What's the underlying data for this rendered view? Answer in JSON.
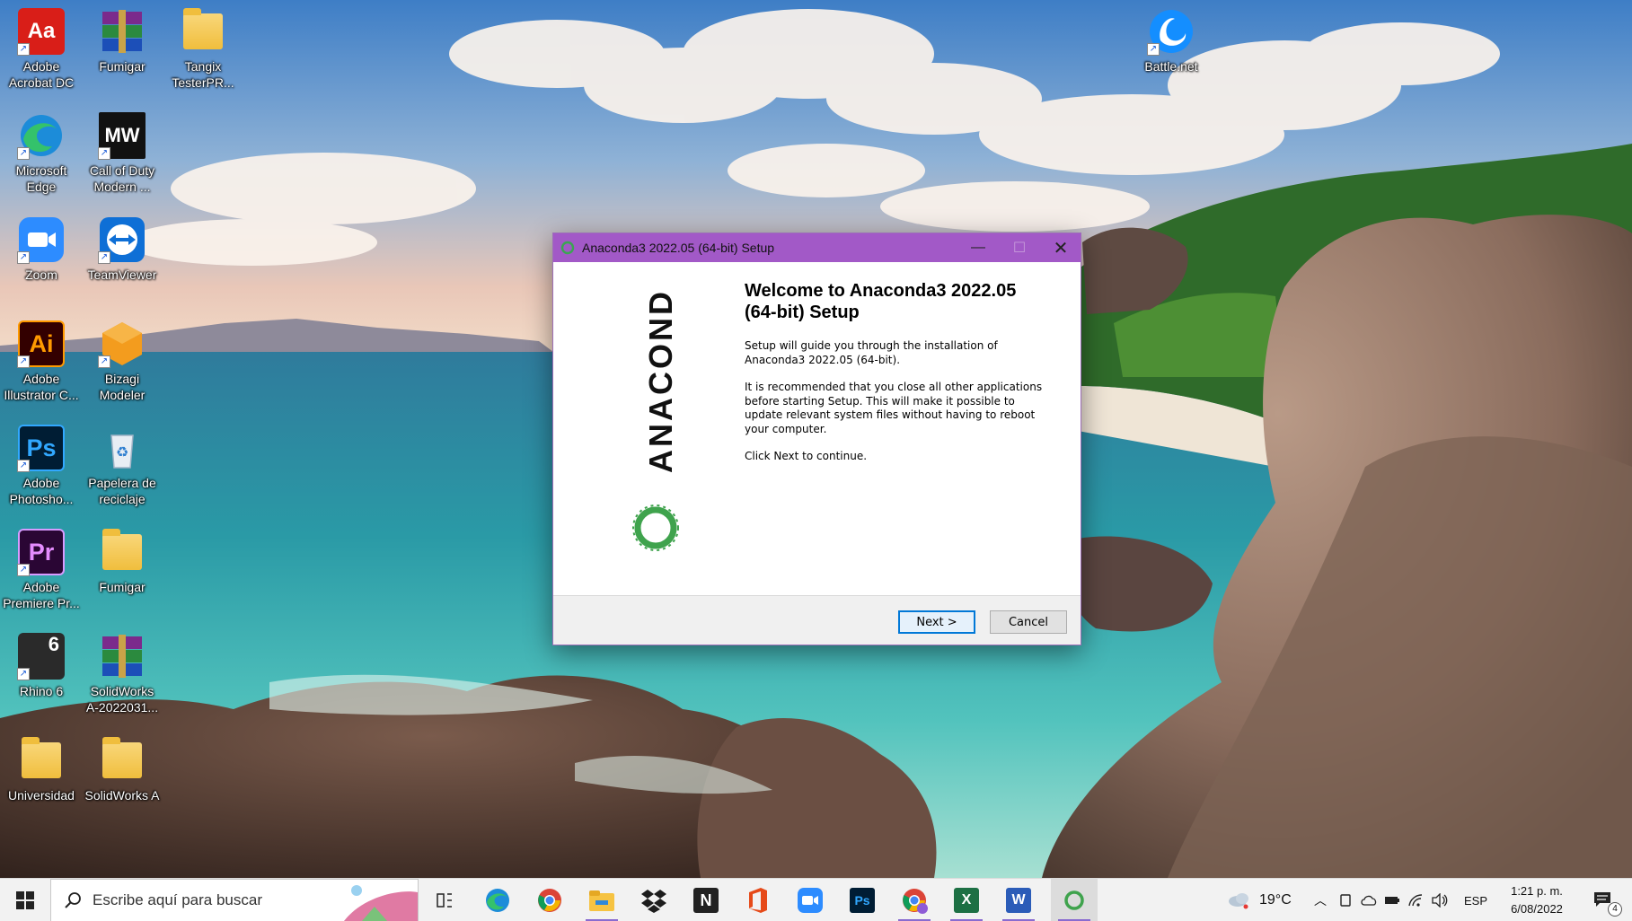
{
  "desktop": {
    "icons": [
      {
        "name": "adobe-acrobat-dc-icon",
        "label": "Adobe\nAcrobat DC"
      },
      {
        "name": "fumigar-winrar-icon",
        "label": "Fumigar"
      },
      {
        "name": "tangix-folder-icon",
        "label": "Tangix\nTesterPR..."
      },
      {
        "name": "microsoft-edge-icon",
        "label": "Microsoft\nEdge"
      },
      {
        "name": "call-of-duty-icon",
        "label": "Call of Duty\nModern ..."
      },
      {
        "name": "zoom-icon",
        "label": "Zoom"
      },
      {
        "name": "teamviewer-icon",
        "label": "TeamViewer"
      },
      {
        "name": "adobe-illustrator-icon",
        "label": "Adobe\nIllustrator C..."
      },
      {
        "name": "bizagi-modeler-icon",
        "label": "Bizagi\nModeler"
      },
      {
        "name": "adobe-photoshop-icon",
        "label": "Adobe\nPhotosho..."
      },
      {
        "name": "recycle-bin-icon",
        "label": "Papelera de\nreciclaje"
      },
      {
        "name": "adobe-premiere-icon",
        "label": "Adobe\nPremiere Pr..."
      },
      {
        "name": "fumigar-folder-icon",
        "label": "Fumigar"
      },
      {
        "name": "rhino-6-icon",
        "label": "Rhino 6"
      },
      {
        "name": "solidworks-winrar-icon",
        "label": "SolidWorks\nA-2022031..."
      },
      {
        "name": "universidad-folder-icon",
        "label": "Universidad"
      },
      {
        "name": "solidworks-a-folder-icon",
        "label": "SolidWorks A"
      },
      {
        "name": "battle-net-icon",
        "label": "Battle.net"
      }
    ]
  },
  "dialog": {
    "title": "Anaconda3 2022.05 (64-bit) Setup",
    "brand": "ANACONDA.",
    "heading_line1": "Welcome to Anaconda3 2022.05",
    "heading_line2": "(64-bit) Setup",
    "para1": "Setup will guide you through the installation of Anaconda3 2022.05 (64-bit).",
    "para2": "It is recommended that you close all other applications before starting Setup. This will make it possible to update relevant system files without having to reboot your computer.",
    "para3": "Click Next to continue.",
    "next_label": "Next >",
    "cancel_label": "Cancel",
    "accent": "#a259c7"
  },
  "taskbar": {
    "search_placeholder": "Escribe aquí para buscar",
    "temperature": "19°C",
    "language": "ESP",
    "time": "1:21 p. m.",
    "date": "6/08/2022",
    "notification_count": "4",
    "pinned": [
      "task-view",
      "edge",
      "chrome",
      "file-explorer",
      "dropbox",
      "notion",
      "office",
      "zoom",
      "photoshop",
      "chrome-profile",
      "excel",
      "word",
      "anaconda-setup"
    ]
  },
  "icons": {
    "acrobat": "Aa",
    "callofduty": "MW",
    "illustrator": "Ai",
    "photoshop": "Ps",
    "premiere": "Pr",
    "rhino": "6",
    "notion": "N",
    "excel": "X",
    "word": "W",
    "ps_task": "Ps"
  }
}
